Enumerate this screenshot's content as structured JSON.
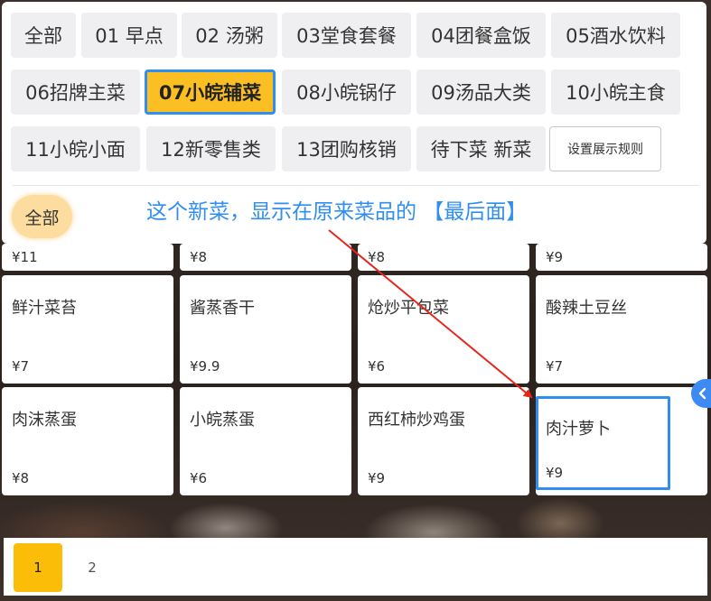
{
  "categories": [
    {
      "label": "全部"
    },
    {
      "label": "01 早点"
    },
    {
      "label": "02 汤粥"
    },
    {
      "label": "03堂食套餐"
    },
    {
      "label": "04团餐盒饭"
    },
    {
      "label": "05酒水饮料"
    },
    {
      "label": "06招牌主菜"
    },
    {
      "label": "07小皖辅菜"
    },
    {
      "label": "08小皖锅仔"
    },
    {
      "label": "09汤品大类"
    },
    {
      "label": "10小皖主食"
    },
    {
      "label": "11小皖小面"
    },
    {
      "label": "12新零售类"
    },
    {
      "label": "13团购核销"
    },
    {
      "label": "待下菜 新菜"
    }
  ],
  "rules_button": "设置展示规则",
  "sub_all": "全部",
  "annotation": "这个新菜，显示在原来菜品的 【最后面】",
  "partial_prices": [
    "¥11",
    "¥8",
    "¥8",
    "¥9"
  ],
  "items": [
    {
      "name": "鲜汁菜苔",
      "price": "¥7"
    },
    {
      "name": "酱蒸香干",
      "price": "¥9.9"
    },
    {
      "name": "炝炒平包菜",
      "price": "¥6"
    },
    {
      "name": "酸辣土豆丝",
      "price": "¥7"
    },
    {
      "name": "肉沫蒸蛋",
      "price": "¥8"
    },
    {
      "name": "小皖蒸蛋",
      "price": "¥6"
    },
    {
      "name": "西红柿炒鸡蛋",
      "price": "¥9"
    },
    {
      "name": "肉汁萝卜",
      "price": "¥9"
    }
  ],
  "pagination": {
    "pages": [
      "1",
      "2"
    ],
    "current": "1"
  },
  "colors": {
    "accent_blue": "#2f8ef0",
    "active_yellow": "#fbbf24",
    "arrow_red": "#e8251c"
  }
}
